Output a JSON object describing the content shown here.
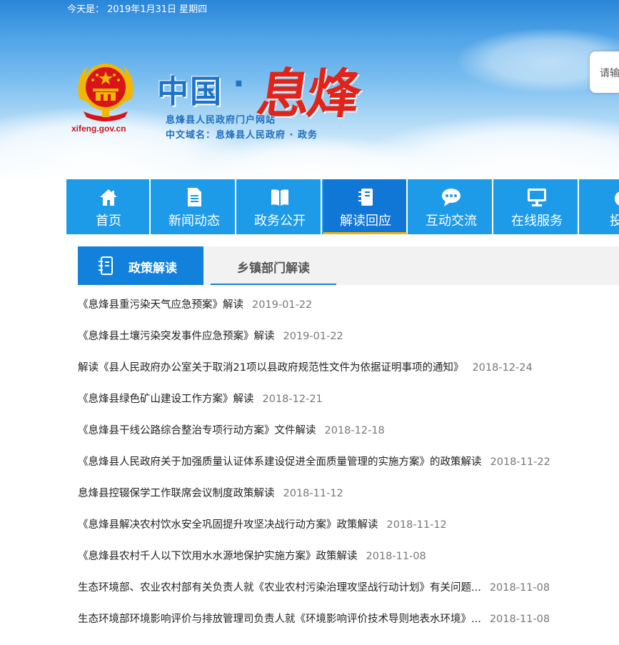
{
  "header": {
    "date_text": "今天是： 2019年1月31日 星期四",
    "site_domain": "xifeng.gov.cn",
    "title_main": "中国",
    "title_dot": "·",
    "title_county": "息烽",
    "subtitle_portal": "息烽县人民政府门户网站",
    "subtitle_domain": "中文域名：息烽县人民政府 · 政务",
    "search_placeholder": "请输"
  },
  "nav": {
    "items": [
      {
        "label": "首页",
        "icon": "home-icon"
      },
      {
        "label": "新闻动态",
        "icon": "document-icon"
      },
      {
        "label": "政务公开",
        "icon": "book-icon"
      },
      {
        "label": "解读回应",
        "icon": "notebook-icon",
        "active": true
      },
      {
        "label": "互动交流",
        "icon": "chat-icon"
      },
      {
        "label": "在线服务",
        "icon": "monitor-icon"
      },
      {
        "label": "投资",
        "icon": "money-icon"
      }
    ]
  },
  "tabs": {
    "policy_label": "政策解读",
    "town_label": "乡镇部门解读"
  },
  "articles": [
    {
      "title": "《息烽县重污染天气应急预案》解读",
      "date": "2019-01-22"
    },
    {
      "title": "《息烽县土壤污染突发事件应急预案》解读",
      "date": "2019-01-22"
    },
    {
      "title": "解读《县人民政府办公室关于取消21项以县政府规范性文件为依据证明事项的通知》",
      "date": "2018-12-24"
    },
    {
      "title": "《息烽县绿色矿山建设工作方案》解读",
      "date": "2018-12-21"
    },
    {
      "title": "《息烽县干线公路综合整治专项行动方案》文件解读",
      "date": "2018-12-18"
    },
    {
      "title": "《息烽县人民政府关于加强质量认证体系建设促进全面质量管理的实施方案》的政策解读",
      "date": "2018-11-22"
    },
    {
      "title": "息烽县控辍保学工作联席会议制度政策解读",
      "date": "2018-11-12"
    },
    {
      "title": "《息烽县解决农村饮水安全巩固提升攻坚决战行动方案》政策解读",
      "date": "2018-11-12"
    },
    {
      "title": "《息烽县农村千人以下饮用水水源地保护实施方案》政策解读",
      "date": "2018-11-08"
    },
    {
      "title": "生态环境部、农业农村部有关负责人就《农业农村污染治理攻坚战行动计划》有关问题...",
      "date": "2018-11-08"
    },
    {
      "title": "生态环境部环境影响评价与排放管理司负责人就《环境影响评价技术导则地表水环境》...",
      "date": "2018-11-08"
    }
  ],
  "colors": {
    "nav_bg": "#1e9be8",
    "nav_active": "#1077d6",
    "nav_active_underline": "#f4b400",
    "tab_active": "#1281dc",
    "title_red": "#e2231a",
    "title_blue": "#1e73c8"
  }
}
